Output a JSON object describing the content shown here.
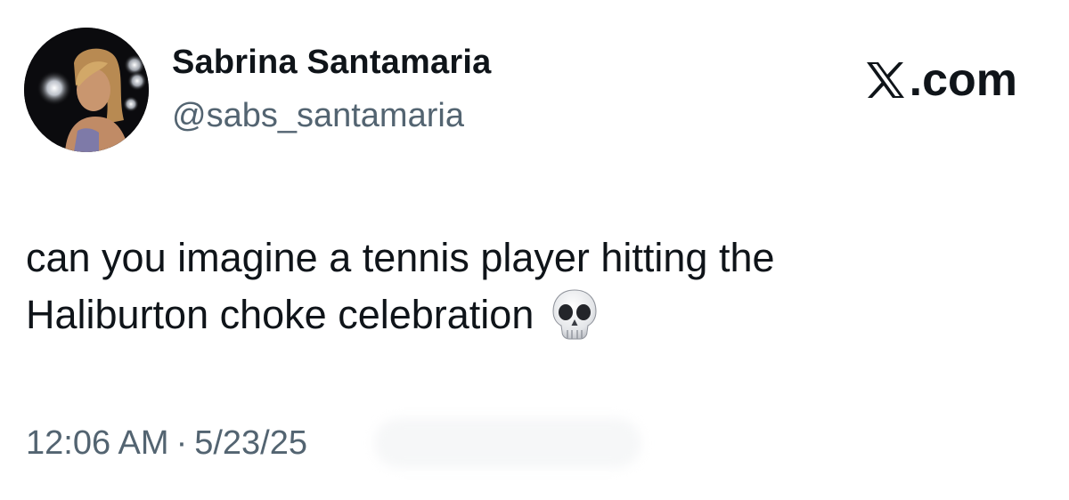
{
  "tweet": {
    "author": {
      "name": "Sabrina Santamaria",
      "handle": "@sabs_santamaria"
    },
    "brand": {
      "icon": "x-logo-icon",
      "label": ".com"
    },
    "text": {
      "line1": "can you imagine a tennis player hitting the",
      "line2": "Haliburton choke celebration",
      "emoji": "skull-emoji"
    },
    "meta": {
      "time": "12:06 AM",
      "separator": "·",
      "date": "5/23/25"
    },
    "colors": {
      "text": "#0f1419",
      "secondary": "#536471",
      "background": "#ffffff"
    }
  }
}
